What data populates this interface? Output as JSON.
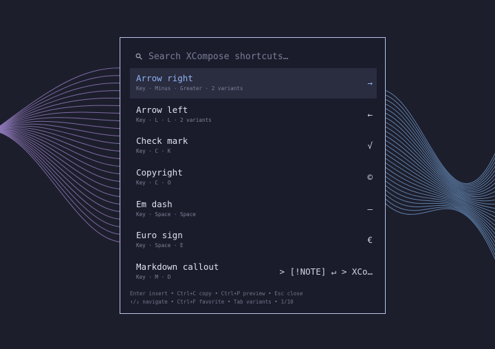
{
  "search": {
    "placeholder": "Search XCompose shortcuts…",
    "icon": "search-icon"
  },
  "results": [
    {
      "title": "Arrow right",
      "keys": "Key · Minus · Greater · 2 variants",
      "result": "→",
      "selected": true
    },
    {
      "title": "Arrow left",
      "keys": "Key · L · L · 2 variants",
      "result": "←",
      "selected": false
    },
    {
      "title": "Check mark",
      "keys": "Key · C · K",
      "result": "√",
      "selected": false
    },
    {
      "title": "Copyright",
      "keys": "Key · C · O",
      "result": "©",
      "selected": false
    },
    {
      "title": "Em dash",
      "keys": "Key · Space · Space",
      "result": "—",
      "selected": false
    },
    {
      "title": "Euro sign",
      "keys": "Key · Space · E",
      "result": "€",
      "selected": false
    },
    {
      "title": "Markdown callout",
      "keys": "Key · M · D",
      "result": "> [!NOTE] ↵ > XCo…",
      "selected": false
    }
  ],
  "footer": {
    "line1": "Enter insert  •  Ctrl+C copy  •  Ctrl+P preview  •  Esc close",
    "line2": "↑/↓ navigate  •  Ctrl+F favorite  •  Tab variants  •  1/10"
  },
  "colors": {
    "background": "#1d1e2c",
    "panel_border": "#b7c6ea",
    "selected_row": "#2a2c40",
    "accent": "#8fb3f2",
    "wave_left": "#8e79b8",
    "wave_right": "#6f98c8"
  }
}
